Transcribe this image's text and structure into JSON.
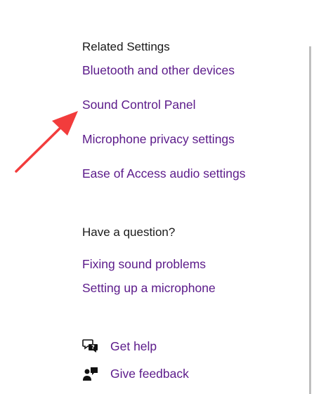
{
  "related_settings": {
    "heading": "Related Settings",
    "links": [
      {
        "label": "Bluetooth and other devices"
      },
      {
        "label": "Sound Control Panel"
      },
      {
        "label": "Microphone privacy settings"
      },
      {
        "label": "Ease of Access audio settings"
      }
    ]
  },
  "question": {
    "heading": "Have a question?",
    "links": [
      {
        "label": "Fixing sound problems"
      },
      {
        "label": "Setting up a microphone"
      }
    ]
  },
  "actions": [
    {
      "label": "Get help",
      "icon": "get-help-icon"
    },
    {
      "label": "Give feedback",
      "icon": "give-feedback-icon"
    }
  ],
  "colors": {
    "link": "#5b1a8a",
    "heading": "#1a1a1a",
    "annotation_arrow": "#f23c3c"
  }
}
